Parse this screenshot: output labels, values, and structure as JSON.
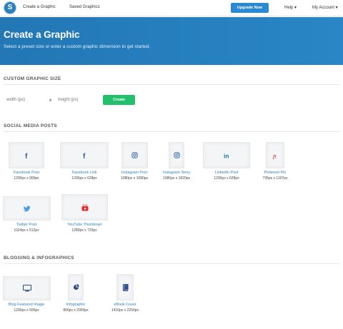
{
  "nav": {
    "create_label": "Create a Graphic",
    "saved_label": "Saved Graphics",
    "upgrade_label": "Upgrade Now",
    "help_label": "Help ▾",
    "account_label": "My Account ▾"
  },
  "hero": {
    "title": "Create a Graphic",
    "subtitle": "Select a preset size or enter a custom graphic dimension to get started."
  },
  "custom": {
    "section_title": "CUSTOM GRAPHIC SIZE",
    "width_placeholder": "width (px)",
    "separator": "x",
    "height_placeholder": "height (px)",
    "create_label": "Create"
  },
  "social": {
    "section_title": "SOCIAL MEDIA POSTS",
    "items": [
      {
        "label": "Facebook Post",
        "size": "1200px x 900px",
        "icon": "facebook-icon"
      },
      {
        "label": "Facebook Link",
        "size": "1200px x 628px",
        "icon": "facebook-icon"
      },
      {
        "label": "Instagram Post",
        "size": "1080px x 1080px",
        "icon": "instagram-icon"
      },
      {
        "label": "Instagram Story",
        "size": "1080px x 1920px",
        "icon": "instagram-icon"
      },
      {
        "label": "LinkedIn Post",
        "size": "1200px x 628px",
        "icon": "linkedin-icon"
      },
      {
        "label": "Pinterest Pin",
        "size": "735px x 1107px",
        "icon": "pinterest-icon"
      },
      {
        "label": "Twitter Post",
        "size": "1024px x 512px",
        "icon": "twitter-icon"
      },
      {
        "label": "YouTube Thumbnail",
        "size": "1280px x 720px",
        "icon": "youtube-icon"
      }
    ]
  },
  "blogging": {
    "section_title": "BLOGGING & INFOGRAPHICS",
    "items": [
      {
        "label": "Blog Featured Image",
        "size": "1200px x 600px",
        "icon": "monitor-icon"
      },
      {
        "label": "Infographic",
        "size": "800px x 2000px",
        "icon": "pie-chart-icon"
      },
      {
        "label": "eBook Cover",
        "size": "1410px x 2250px",
        "icon": "book-icon"
      }
    ]
  },
  "colors": {
    "accent_blue": "#2a8ad1",
    "create_green": "#22c06b",
    "link_blue": "#2d82c4",
    "facebook": "#3b5998",
    "instagram": "#3f6fb0",
    "linkedin": "#0e76a8",
    "pinterest": "#cb2027",
    "twitter": "#4a9fe0",
    "youtube": "#e52d27"
  }
}
